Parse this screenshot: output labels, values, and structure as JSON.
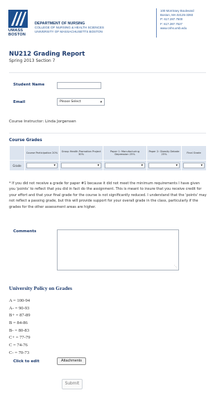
{
  "header": {
    "logo_text": [
      "UMASS",
      "BOSTON"
    ],
    "department": "DEPARTMENT OF NURSING",
    "college": "COLLEGE OF NURSING & HEALTH SCIENCES",
    "university": "UNIVERSITY OF MASSACHUSETTS BOSTON",
    "contact": [
      "100 Morrissey Boulevard",
      "Boston, MA 02125-3393",
      "P: 617.287.7500",
      "F: 617.287.7527",
      "www.cnhs.umb.edu"
    ]
  },
  "report": {
    "title": "NU212 Grading Report",
    "subtitle": "Spring 2013 Section 7"
  },
  "form": {
    "student_name_label": "Student Name",
    "student_name_value": "",
    "email_label": "Email",
    "email_selected": "Please Select",
    "instructor": "Course Instructor: Linda Jorgensen"
  },
  "grades": {
    "title": "Course Grades",
    "columns": [
      "Course Participation 20%",
      "Group Health Promotion Project 30%",
      "Paper 1: Manufacturing Depression 25%",
      "Paper 2: Obesity Debate 25%",
      "Final Grade"
    ],
    "row_label": "Grade",
    "values": [
      "",
      "",
      "",
      "",
      ""
    ]
  },
  "note": "* If you did not receive a grade for paper #1 because it did not meet the minimum requirements I have given you 'points' to reflect that you did in fact do the assignment. This is meant to insure that you receive credit for your effort and that your final grade for the course is not significantly reduced. I understand that the 'points' may not reflect a passing grade, but this will provide support for your overall grade in the class, particularly if the grades for the other assessment areas are higher.",
  "comments": {
    "label": "Comments",
    "value": ""
  },
  "policy": {
    "title": "University Policy on Grades",
    "scale": [
      "A  = 100-94",
      "A-  = 90-93",
      "B+  = 87-89",
      "B  = 84-86",
      "B-  = 80-83",
      "C+  = 77-79",
      "C  = 74-76",
      "C-  = 70-73"
    ]
  },
  "actions": {
    "click_to_edit_label": "Click to edit",
    "attachments_label": "Attachments",
    "submit_label": "Submit"
  },
  "colors": {
    "brand_blue": "#173a6b",
    "link_blue": "#2b5a98",
    "table_bg": "#dce4ef"
  }
}
